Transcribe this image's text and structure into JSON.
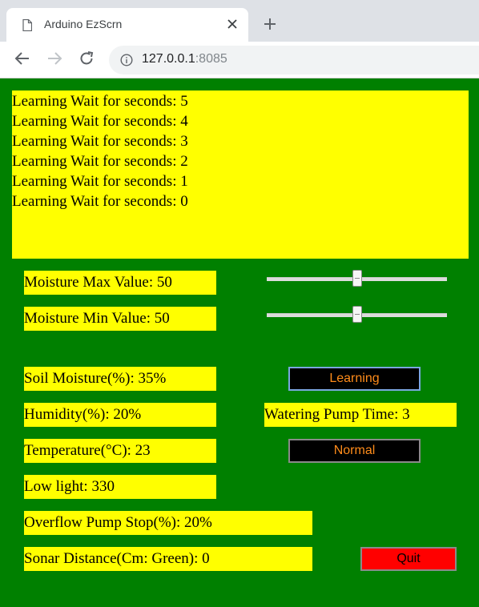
{
  "browser": {
    "tab_title": "Arduino EzScrn",
    "url_host": "127.0.0.1",
    "url_port": ":8085"
  },
  "log_lines": [
    "Learning Wait for seconds: 5",
    "Learning Wait for seconds: 4",
    "Learning Wait for seconds: 3",
    "Learning Wait for seconds: 2",
    "Learning Wait for seconds: 1",
    "Learning Wait for seconds: 0"
  ],
  "moisture": {
    "max_label": "Moisture Max Value: 50",
    "min_label": "Moisture Min Value: 50",
    "max_value": 50,
    "min_value": 50
  },
  "readings": {
    "soil_moisture": "Soil Moisture(%): 35%",
    "humidity": "Humidity(%): 20%",
    "temperature": "Temperature(°C): 23",
    "low_light": "Low light: 330",
    "overflow_pump_stop": "Overflow Pump Stop(%): 20%",
    "sonar_distance": "Sonar Distance(Cm: Green): 0",
    "watering_pump_time": "Watering Pump Time: 3"
  },
  "buttons": {
    "learning": "Learning",
    "normal": "Normal",
    "quit": "Quit"
  },
  "colors": {
    "page_background": "#008000",
    "label_background": "#ffff00",
    "button_text": "#ff8c1a",
    "quit_button": "#ff0000"
  }
}
